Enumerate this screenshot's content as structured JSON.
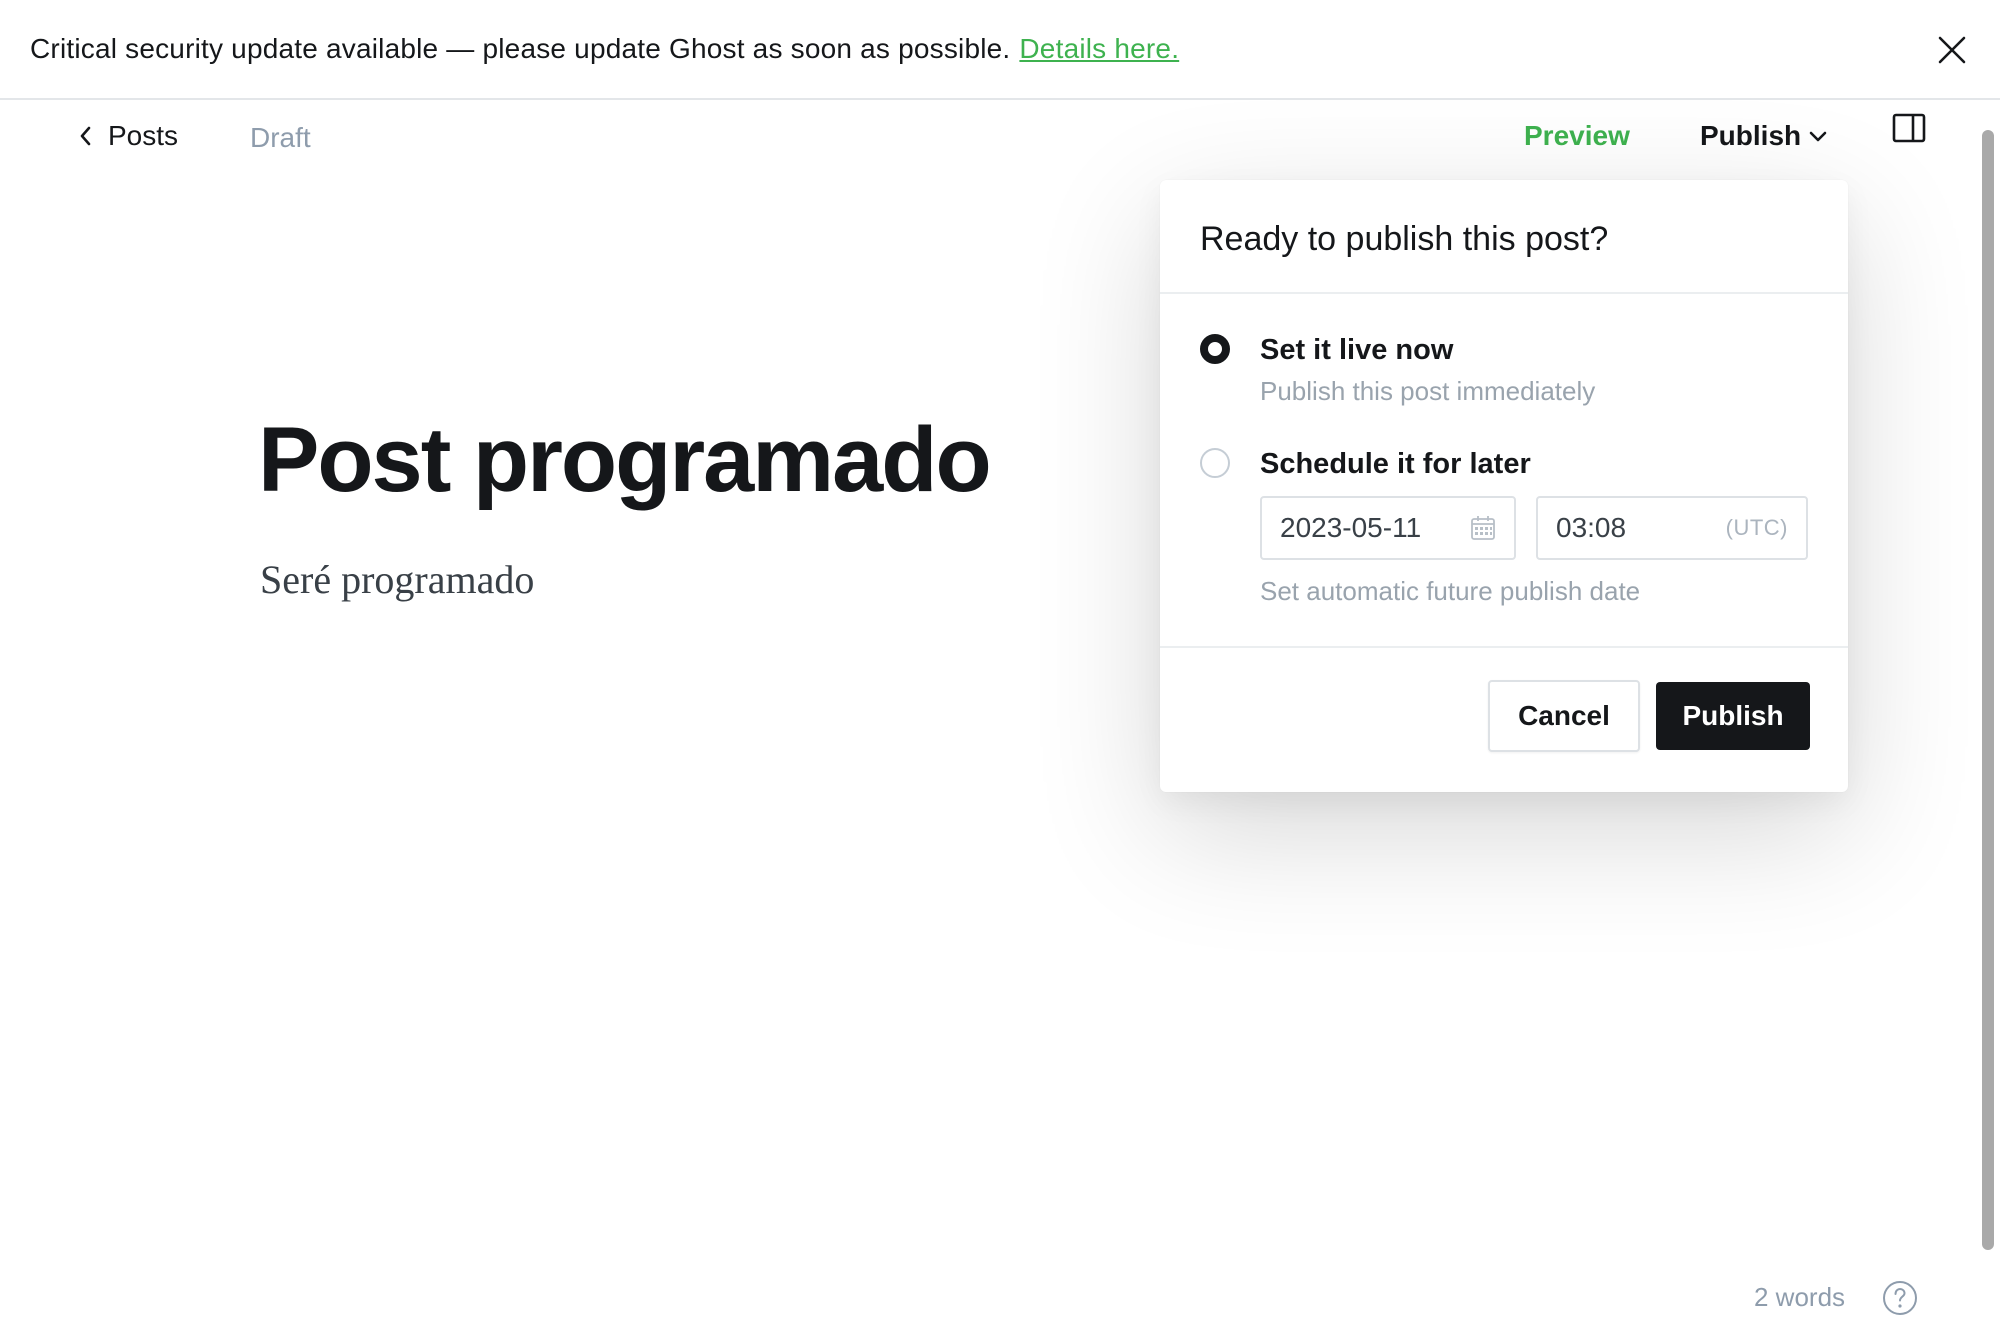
{
  "banner": {
    "message": "Critical security update available — please update Ghost as soon as possible.",
    "link_text": "Details here."
  },
  "header": {
    "back_label": "Posts",
    "status": "Draft",
    "preview_label": "Preview",
    "publish_menu_label": "Publish"
  },
  "post": {
    "title": "Post programado",
    "body": "Seré programado"
  },
  "publish_dropdown": {
    "title": "Ready to publish this post?",
    "options": [
      {
        "label": "Set it live now",
        "description": "Publish this post immediately",
        "selected": true
      },
      {
        "label": "Schedule it for later",
        "description": "Set automatic future publish date",
        "selected": false
      }
    ],
    "date_value": "2023-05-11",
    "time_value": "03:08",
    "timezone": "(UTC)",
    "cancel_label": "Cancel",
    "publish_label": "Publish"
  },
  "footer": {
    "word_count": "2 words"
  },
  "colors": {
    "accent_green": "#3eb24f",
    "text_dark": "#15171a",
    "muted": "#99a3ad"
  }
}
